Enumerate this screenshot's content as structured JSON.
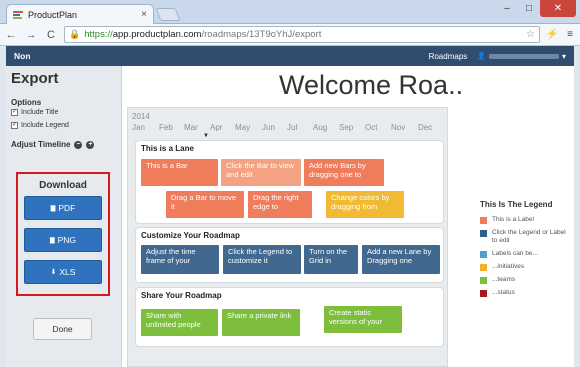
{
  "browser": {
    "tab_title": "ProductPlan",
    "tab_close": "×",
    "url_https": "https://",
    "url_host": "app.productplan.com",
    "url_path": "/roadmaps/13T9oYhJ/export",
    "back": "←",
    "forward": "→",
    "reload": "C",
    "lock": "🔒",
    "star": "☆",
    "ext1": "⚡",
    "menu": "≡",
    "minimize": "–",
    "maximize": "□",
    "close": "✕"
  },
  "app": {
    "brand": "Non",
    "nav_roadmaps": "Roadmaps",
    "user_icon": "👤",
    "caret": "▾"
  },
  "sidebar": {
    "title": "Export",
    "options_heading": "Options",
    "opt_title": "Include Title",
    "opt_legend": "Include Legend",
    "check": "✓",
    "adjust_timeline": "Adjust Timeline",
    "minus": "−",
    "plus": "+",
    "download_heading": "Download",
    "btn_pdf": "PDF",
    "btn_png": "PNG",
    "btn_xls": "XLS",
    "file_icon": "▇",
    "down_icon": "⬇",
    "done": "Done"
  },
  "main": {
    "heading": "Welcome Roa..",
    "year": "2014",
    "months": [
      "Jan",
      "Feb",
      "Mar",
      "Apr",
      "May",
      "Jun",
      "Jul",
      "Aug",
      "Sep",
      "Oct",
      "Nov",
      "Dec"
    ],
    "marker": "▼",
    "lanes": [
      {
        "title": "This is a Lane",
        "bars": [
          "This is a Bar",
          "Click the Bar to view and edit",
          "Add new Bars by dragging one to",
          "Drag a Bar to move it",
          "Drag the right edge to",
          "Change colors by dragging from"
        ]
      },
      {
        "title": "Customize Your Roadmap",
        "bars": [
          "Adjust the time frame of your",
          "Click the Legend to customize it",
          "Turn on the Grid in",
          "Add a new Lane by Dragging one"
        ]
      },
      {
        "title": "Share Your Roadmap",
        "bars": [
          "Share with unlimited people",
          "Share a private link",
          "Create static versions of your"
        ]
      }
    ]
  },
  "legend": {
    "title": "This Is The Legend",
    "items": [
      {
        "label": "This is a Label",
        "color": "#ef7d5b"
      },
      {
        "label": "Click the Legend or Label to edit",
        "color": "#2f5f8c"
      },
      {
        "label": "Labels can be...",
        "color": "#4d9fd6"
      },
      {
        "label": "...initiatives",
        "color": "#f0b22c"
      },
      {
        "label": "...teams",
        "color": "#7cbf3f"
      },
      {
        "label": "...status",
        "color": "#a61c1c"
      }
    ]
  },
  "colors": {
    "orange": "#ef7d5b",
    "light_orange": "#f3a284",
    "yellow": "#f2ba33",
    "navy": "#41698f",
    "green": "#7dbe3d",
    "header": "#2e4d6f",
    "download_border": "#d4191c",
    "button": "#2f73bf"
  }
}
